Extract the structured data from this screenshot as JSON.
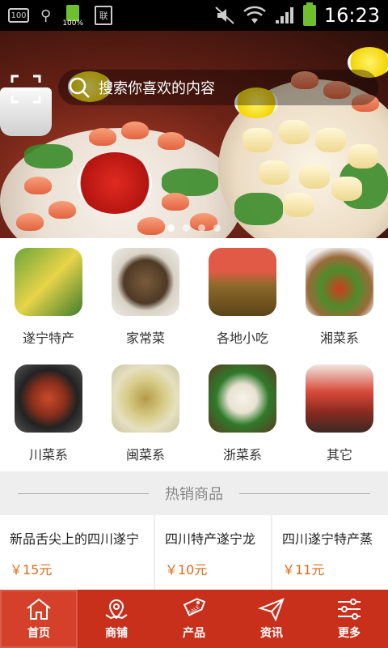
{
  "status_bar": {
    "battery_small": "100",
    "battery_percent": "100%",
    "sim_label": "联",
    "time": "16:23"
  },
  "search": {
    "placeholder": "搜索你喜欢的内容"
  },
  "banner": {
    "dots": 4,
    "active_dot": 0
  },
  "categories": [
    {
      "label": "遂宁特产"
    },
    {
      "label": "家常菜"
    },
    {
      "label": "各地小吃"
    },
    {
      "label": "湘菜系"
    },
    {
      "label": "川菜系"
    },
    {
      "label": "闽菜系"
    },
    {
      "label": "浙菜系"
    },
    {
      "label": "其它"
    }
  ],
  "hot": {
    "title": "热销商品",
    "products": [
      {
        "name": "新品舌尖上的四川遂宁",
        "price": "￥15元"
      },
      {
        "name": "四川特产遂宁龙",
        "price": "￥10元"
      },
      {
        "name": "四川遂宁特产蒸",
        "price": "￥11元"
      }
    ]
  },
  "nav": [
    {
      "label": "首页",
      "icon": "home-icon",
      "active": true
    },
    {
      "label": "商铺",
      "icon": "map-pin-icon",
      "active": false
    },
    {
      "label": "产品",
      "icon": "sale-tag-icon",
      "active": false
    },
    {
      "label": "资讯",
      "icon": "send-icon",
      "active": false
    },
    {
      "label": "更多",
      "icon": "sliders-icon",
      "active": false
    }
  ],
  "colors": {
    "nav_bg": "#c9301c",
    "price": "#e06a1a"
  }
}
